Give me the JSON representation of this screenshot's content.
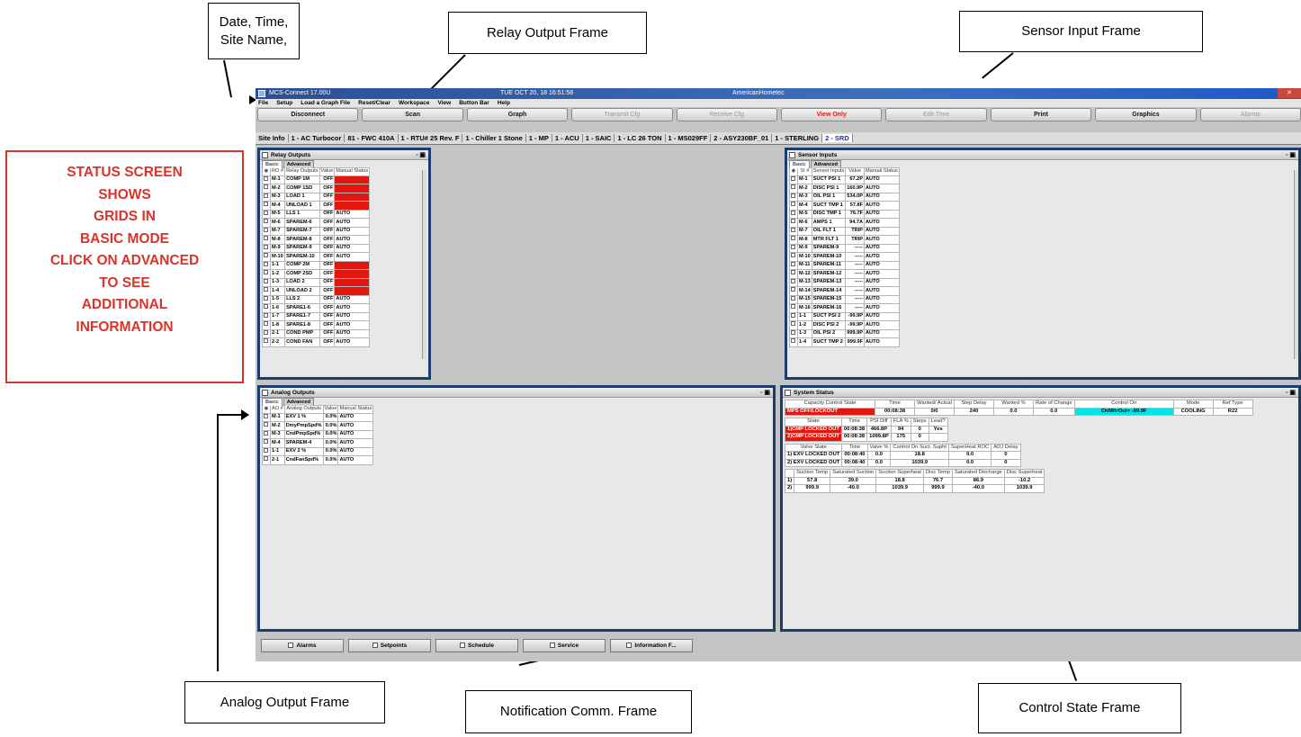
{
  "callouts": {
    "date_time_site": "Date, Time, Site Name,",
    "relay_output_frame": "Relay Output Frame",
    "sensor_input_frame": "Sensor Input Frame",
    "analog_output_frame": "Analog Output  Frame",
    "notification_frame": "Notification Comm. Frame",
    "control_state_frame": "Control State Frame"
  },
  "status_note": [
    "STATUS SCREEN",
    "SHOWS",
    "GRIDS IN",
    "BASIC MODE",
    "CLICK ON ADVANCED",
    "TO SEE",
    "ADDITIONAL",
    "INFORMATION"
  ],
  "app": {
    "title": "MCS-Connect 17.00U",
    "datetime": "TUE OCT 20, 18  16:51:58",
    "site": "AmericanHometec",
    "menu": [
      "File",
      "Setup",
      "Load a Graph File",
      "Reset/Clear",
      "Workspace",
      "View",
      "Button Bar",
      "Help"
    ],
    "toolbar": [
      {
        "label": "Disconnect",
        "state": "normal"
      },
      {
        "label": "Scan",
        "state": "normal"
      },
      {
        "label": "Graph",
        "state": "normal"
      },
      {
        "label": "Transmit Cfg",
        "state": "disabled"
      },
      {
        "label": "Receive Cfg",
        "state": "disabled"
      },
      {
        "label": "View Only",
        "state": "red"
      },
      {
        "label": "Edit Time",
        "state": "disabled"
      },
      {
        "label": "Print",
        "state": "normal"
      },
      {
        "label": "Graphics",
        "state": "normal"
      },
      {
        "label": "Alarms",
        "state": "disabled"
      }
    ],
    "site_tabs": [
      "Site Info",
      "1 - AC Turbocor",
      "81 - FWC 410A",
      "1 - RTU# 25 Rev. F",
      "1 - Chiller 1 Stone",
      "1 - MP",
      "1 - ACU",
      "1 - SAIC",
      "1 - LC 26 TON",
      "1 - MS029FF",
      "2 - ASY230BF_01",
      "1 - STERLING",
      "2 - SRD"
    ],
    "active_site_tab": "2 - SRD",
    "frame_tabs": [
      "Basic",
      "Advanced"
    ],
    "relay": {
      "title": "Relay Outputs",
      "headers": [
        "RO #",
        "Relay Outputs",
        "Value",
        "Manual Status"
      ],
      "rows": [
        [
          "M-1",
          "COMP 1M",
          "OFF",
          "LOCKOFF"
        ],
        [
          "M-2",
          "COMP 1SD",
          "OFF",
          "LOCKOFF"
        ],
        [
          "M-3",
          "LOAD 1",
          "OFF",
          "LOCKOFF"
        ],
        [
          "M-4",
          "UNLOAD 1",
          "OFF",
          "LOCKOFF"
        ],
        [
          "M-5",
          "LLS 1",
          "OFF",
          "AUTO"
        ],
        [
          "M-6",
          "SPAREM-6",
          "OFF",
          "AUTO"
        ],
        [
          "M-7",
          "SPAREM-7",
          "OFF",
          "AUTO"
        ],
        [
          "M-8",
          "SPAREM-8",
          "OFF",
          "AUTO"
        ],
        [
          "M-9",
          "SPAREM-9",
          "OFF",
          "AUTO"
        ],
        [
          "M-10",
          "SPAREM-10",
          "OFF",
          "AUTO"
        ],
        [
          "1-1",
          "COMP 2M",
          "OFF",
          "LOCKOFF"
        ],
        [
          "1-2",
          "COMP 2SD",
          "OFF",
          "LOCKOFF"
        ],
        [
          "1-3",
          "LOAD 2",
          "OFF",
          "LOCKOFF"
        ],
        [
          "1-4",
          "UNLOAD 2",
          "OFF",
          "LOCKOFF"
        ],
        [
          "1-5",
          "LLS 2",
          "OFF",
          "AUTO"
        ],
        [
          "1-6",
          "SPARE1-6",
          "OFF",
          "AUTO"
        ],
        [
          "1-7",
          "SPARE1-7",
          "OFF",
          "AUTO"
        ],
        [
          "1-8",
          "SPARE1-8",
          "OFF",
          "AUTO"
        ],
        [
          "2-1",
          "COND PMP",
          "OFF",
          "AUTO"
        ],
        [
          "2-2",
          "COND FAN",
          "OFF",
          "AUTO"
        ]
      ]
    },
    "sensor": {
      "title": "Sensor Inputs",
      "headers": [
        "SI #",
        "Sensor Inputs",
        "Value",
        "Manual Status"
      ],
      "rows": [
        [
          "M-1",
          "SUCT PSI 1",
          "67.2P",
          "AUTO"
        ],
        [
          "M-2",
          "DISC PSI 1",
          "160.9P",
          "AUTO"
        ],
        [
          "M-3",
          "OIL PSI 1",
          "534.0P",
          "AUTO"
        ],
        [
          "M-4",
          "SUCT TMP 1",
          "57.8F",
          "AUTO"
        ],
        [
          "M-5",
          "DISC TMP 1",
          "76.7F",
          "AUTO"
        ],
        [
          "M-6",
          "AMPS 1",
          "94.7A",
          "AUTO"
        ],
        [
          "M-7",
          "OIL FLT 1",
          "TRIP",
          "AUTO"
        ],
        [
          "M-8",
          "MTR FLT 1",
          "TRIP",
          "AUTO"
        ],
        [
          "M-9",
          "SPAREM-9",
          "-----",
          "AUTO"
        ],
        [
          "M-10",
          "SPAREM-10",
          "-----",
          "AUTO"
        ],
        [
          "M-11",
          "SPAREM-11",
          "-----",
          "AUTO"
        ],
        [
          "M-12",
          "SPAREM-12",
          "-----",
          "AUTO"
        ],
        [
          "M-13",
          "SPAREM-13",
          "-----",
          "AUTO"
        ],
        [
          "M-14",
          "SPAREM-14",
          "-----",
          "AUTO"
        ],
        [
          "M-15",
          "SPAREM-15",
          "-----",
          "AUTO"
        ],
        [
          "M-16",
          "SPAREM-16",
          "-----",
          "AUTO"
        ],
        [
          "1-1",
          "SUCT PSI 2",
          "-99.9P",
          "AUTO"
        ],
        [
          "1-2",
          "DISC PSI 2",
          "-99.9P",
          "AUTO"
        ],
        [
          "1-3",
          "OIL PSI 2",
          "999.9P",
          "AUTO"
        ],
        [
          "1-4",
          "SUCT TMP 2",
          "999.9F",
          "AUTO"
        ]
      ]
    },
    "analog": {
      "title": "Analog Outputs",
      "headers": [
        "AO #",
        "Analog Outputs",
        "Value",
        "Manual Status"
      ],
      "rows": [
        [
          "M-1",
          "EXV 1 %",
          "0.0%",
          "AUTO"
        ],
        [
          "M-2",
          "DmyPmpSpd%",
          "0.0%",
          "AUTO"
        ],
        [
          "M-3",
          "CndPmpSpd%",
          "0.0%",
          "AUTO"
        ],
        [
          "M-4",
          "SPAREM-4",
          "0.0%",
          "AUTO"
        ],
        [
          "1-1",
          "EXV 2 %",
          "0.0%",
          "AUTO"
        ],
        [
          "2-1",
          "CndFanSpd%",
          "0.0%",
          "AUTO"
        ]
      ]
    },
    "system": {
      "title": "System Status",
      "cap_headers": [
        "Capacity Control State",
        "Time",
        "Wanted/ Actual",
        "Step Delay",
        "Wanted %",
        "Rate of Change",
        "Control On",
        "Mode",
        "Ref Type"
      ],
      "cap_row": [
        "MPS OFF/LOCKOUT",
        "00:08:38",
        "0/0",
        "240",
        "0.0",
        "0.0",
        "ChlWtrOut= -99.9F",
        "COOLING",
        "R22"
      ],
      "comp_headers": [
        "State",
        "Time",
        "PSI Diff",
        "FLA %",
        "Steps",
        "Lead?"
      ],
      "comp_rows": [
        [
          "1)CMP LOCKED OUT",
          "00:08:38",
          "466.8P",
          "94",
          "0",
          "Yes"
        ],
        [
          "2)CMP LOCKED OUT",
          "00:08:38",
          "1099.8P",
          "175",
          "0",
          ""
        ]
      ],
      "valve_headers": [
        "Valve State",
        "Time",
        "Valve %",
        "Control On Suct. Supht",
        "SuperHeat ROC",
        "ADJ Delay"
      ],
      "valve_rows": [
        [
          "1) EXV LOCKED OUT",
          "00:08:40",
          "0.0",
          "18.8",
          "0.0",
          "0"
        ],
        [
          "2) EXV LOCKED OUT",
          "00:08:40",
          "0.0",
          "1039.9",
          "0.0",
          "0"
        ]
      ],
      "suct_headers": [
        "",
        "Suction Temp",
        "Saturated Suction",
        "Suction Superheat",
        "Disc Temp",
        "Saturated Discharge",
        "Disc Superheat"
      ],
      "suct_rows": [
        [
          "1)",
          "57.8",
          "39.0",
          "18.8",
          "76.7",
          "86.9",
          "-10.2"
        ],
        [
          "2)",
          "999.9",
          "-40.0",
          "1039.9",
          "999.9",
          "-40.0",
          "1039.9"
        ]
      ]
    },
    "bottom_tabs": [
      "Alarms",
      "Setpoints",
      "Schedule",
      "Service",
      "Information F..."
    ]
  },
  "colors": {
    "annotation_red": "#d9342b",
    "frame_border": "#1d3c6e",
    "lockoff_red": "#e2170f",
    "highlight_cyan": "#00e5e8"
  }
}
